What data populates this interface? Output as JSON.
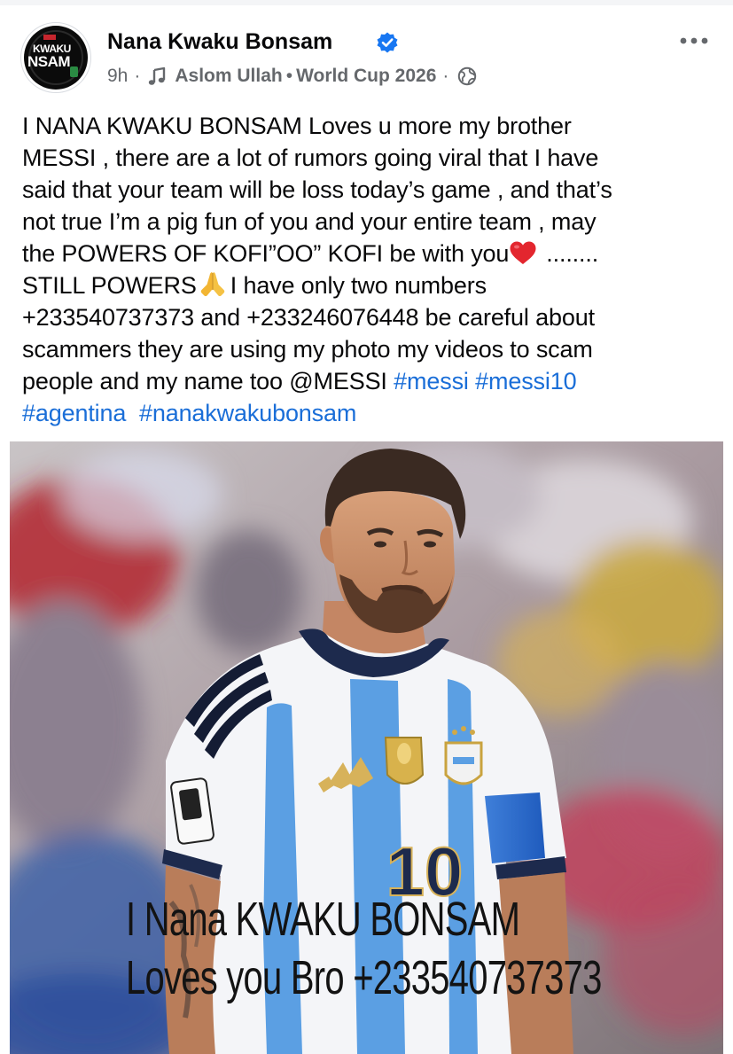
{
  "post": {
    "author": {
      "name": "Nana Kwaku Bonsam",
      "verified_icon": "verified-badge-icon",
      "avatar_text_top": "KWAKU",
      "avatar_text_bottom": "NSAM"
    },
    "meta": {
      "time": "9h",
      "dot": "·",
      "music_icon": "music-note-icon",
      "audio_artist": "Aslom Ullah",
      "separator": "•",
      "audio_title": "World Cup 2026",
      "dot2": "·",
      "privacy_icon": "globe-icon"
    },
    "more_icon": "more-options-icon",
    "text_lines": {
      "l1": "I NANA KWAKU BONSAM Loves u more my brother",
      "l2": "MESSI , there are a lot of rumors going viral that I have",
      "l3": "said that your team will be loss today’s game , and that’s",
      "l4": "not true I’m a pig fun of you and your entire team , may",
      "l5a": "the POWERS OF KOFI”OO” KOFI be with you",
      "l5b": "........",
      "l6a": "STILL POWERS",
      "l6b": "I have only two numbers",
      "l7": "+233540737373 and +233246076448 be careful about",
      "l8": "scammers they are using my photo my videos to scam",
      "l9a": "people and my name too @MESSI ",
      "l9b": "#messi",
      "l9c": "#messi10",
      "l10a": "#agentina",
      "l10b": "#nanakwakubonsam"
    },
    "emojis": {
      "heart": "red-heart-emoji",
      "pray": "folded-hands-emoji"
    },
    "image": {
      "jersey_number": "10",
      "caption_line_1": "I Nana KWAKU BONSAM",
      "caption_line_2": "Loves you Bro +233540737373"
    }
  }
}
